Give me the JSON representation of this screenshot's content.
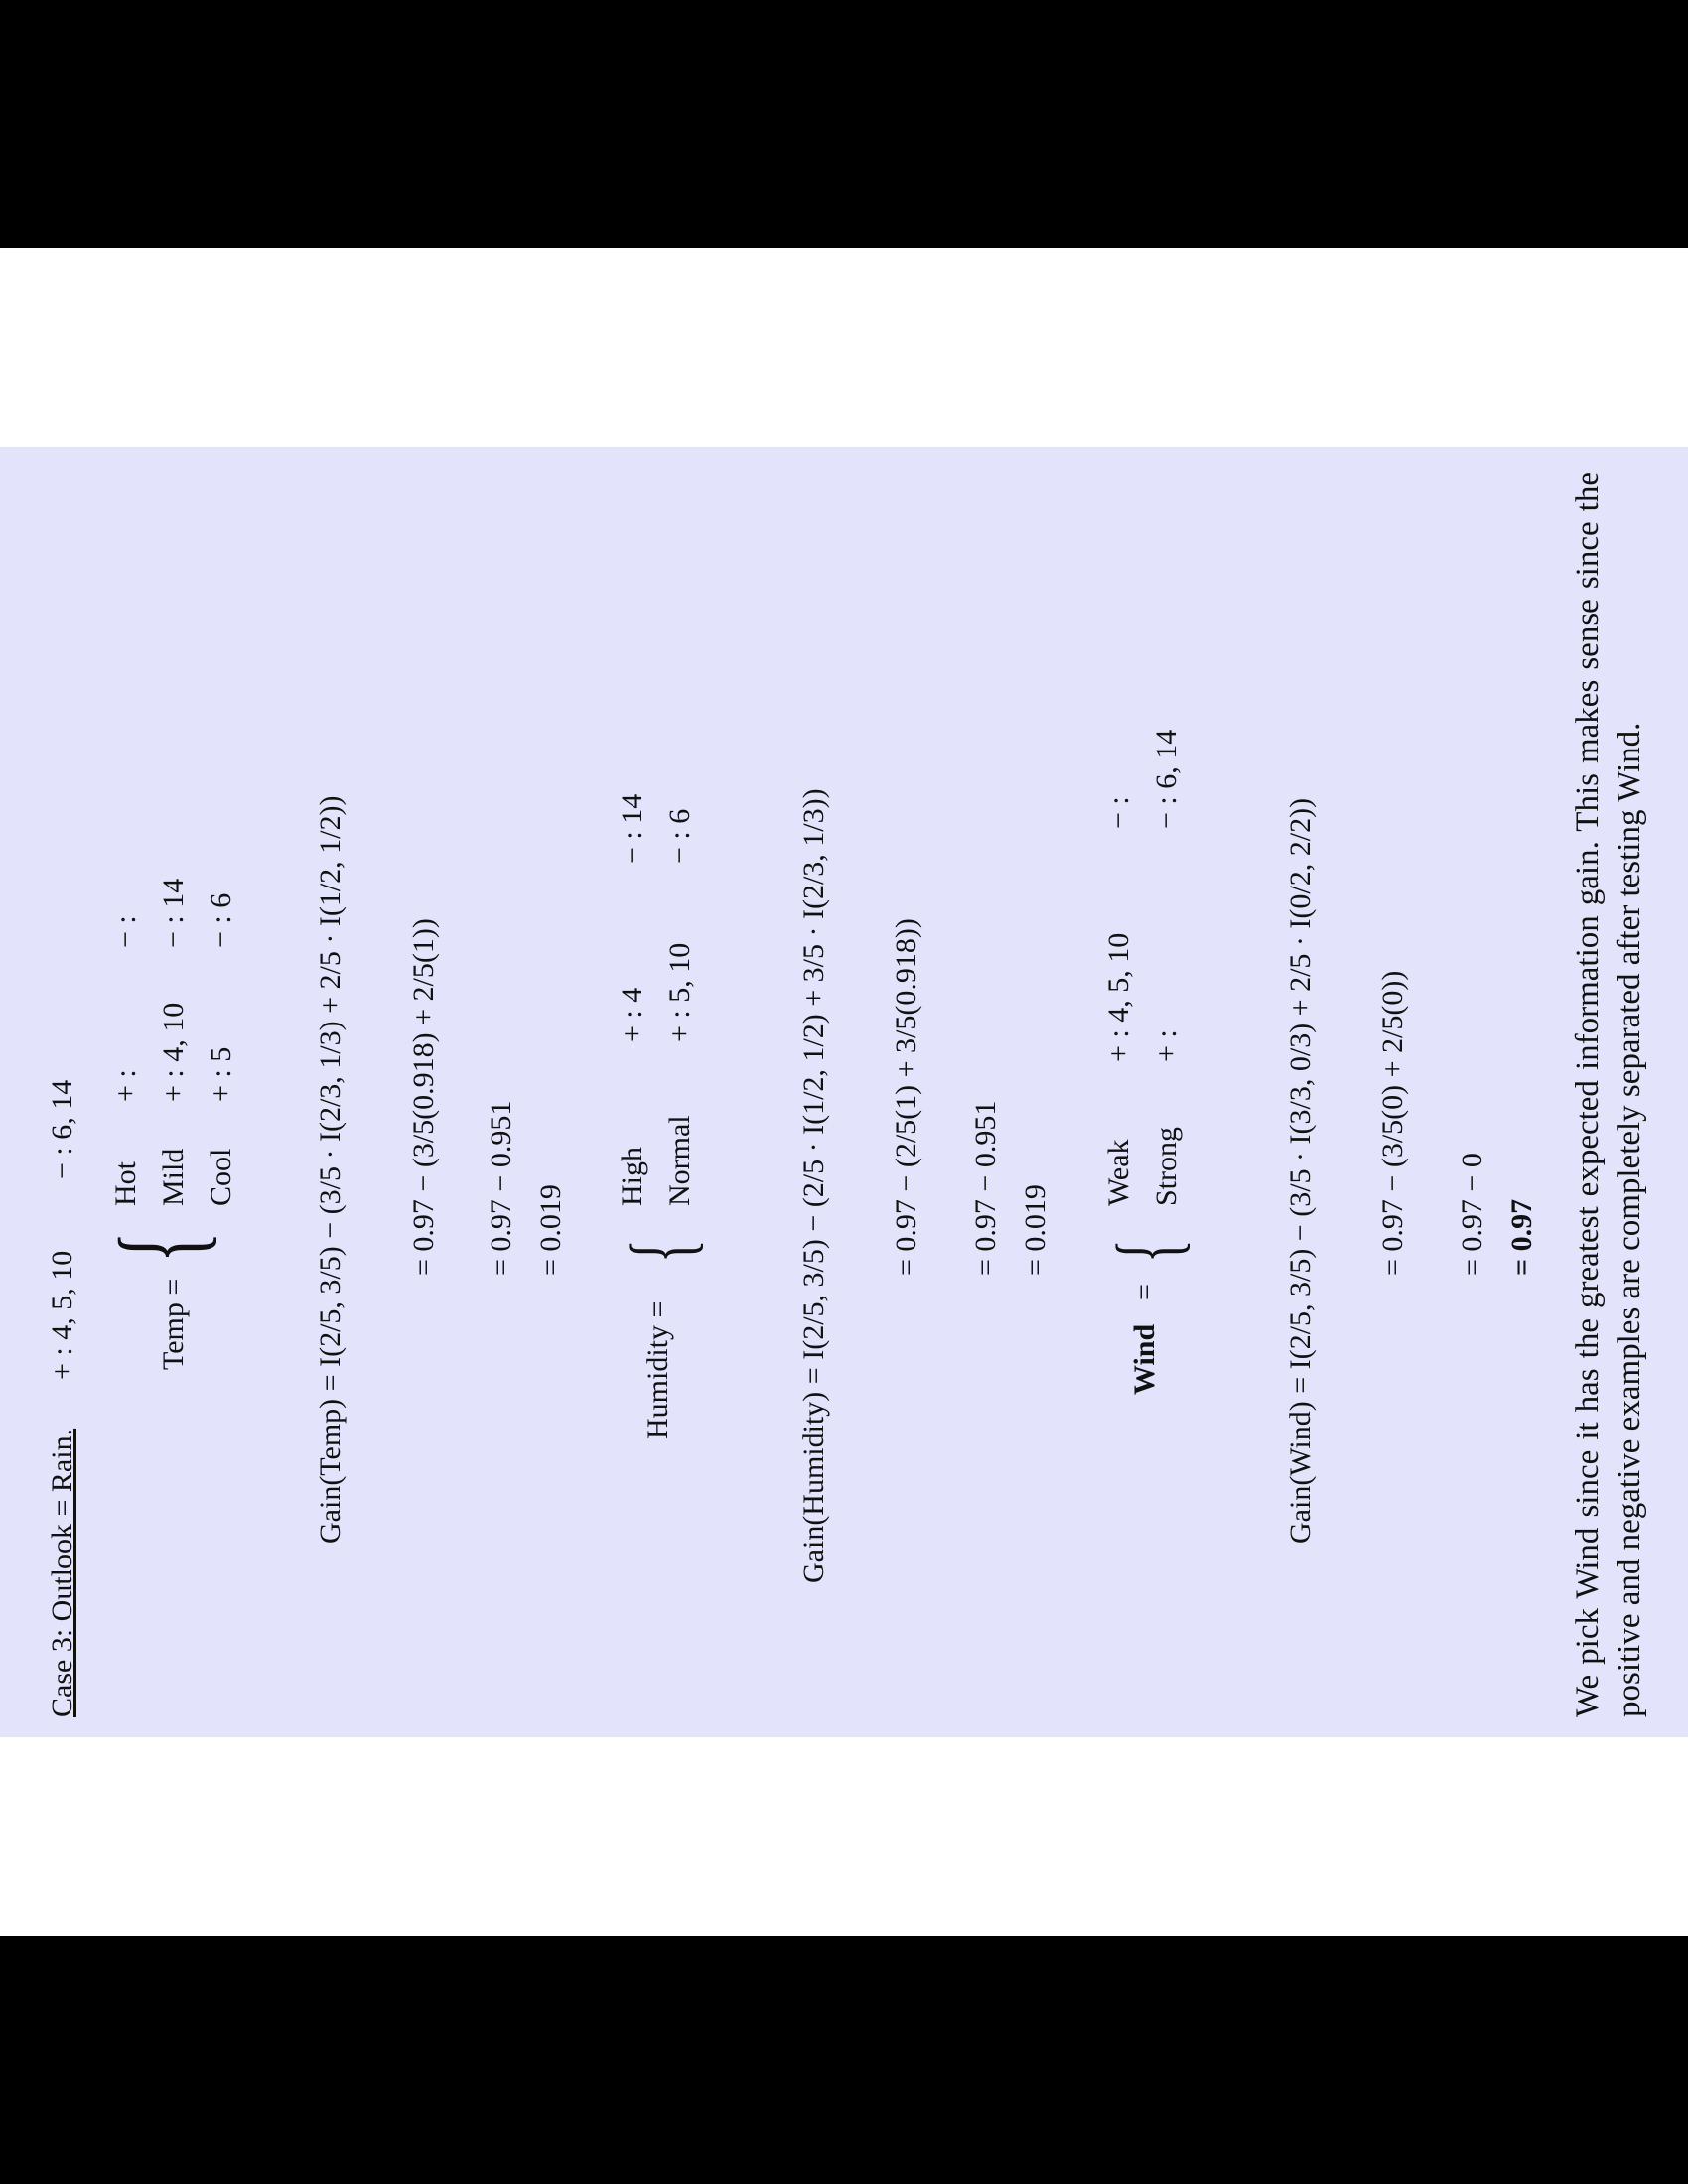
{
  "case3": {
    "heading": "Case 3: Outlook = Rain.",
    "pos": "+ : 4, 5, 10",
    "neg": "− : 6, 14"
  },
  "temp": {
    "label": "Temp =",
    "rows": [
      {
        "name": "Hot",
        "pos": "+ :",
        "neg": "− :"
      },
      {
        "name": "Mild",
        "pos": "+ : 4, 10",
        "neg": "− : 14"
      },
      {
        "name": "Cool",
        "pos": "+ : 5",
        "neg": "− : 6"
      }
    ],
    "gain_lines": [
      "Gain(Temp) = I(2/5, 3/5) − (3/5 · I(2/3, 1/3) + 2/5 · I(1/2, 1/2))",
      "= 0.97 − (3/5(0.918) + 2/5(1))",
      "= 0.97 − 0.951",
      "= 0.019"
    ]
  },
  "humidity": {
    "label": "Humidity =",
    "rows": [
      {
        "name": "High",
        "pos": "+ : 4",
        "neg": "− : 14"
      },
      {
        "name": "Normal",
        "pos": "+ : 5, 10",
        "neg": "− : 6"
      }
    ],
    "gain_lines": [
      "Gain(Humidity) = I(2/5, 3/5) − (2/5 · I(1/2, 1/2) + 3/5 · I(2/3, 1/3))",
      "= 0.97 − (2/5(1) + 3/5(0.918))",
      "= 0.97 − 0.951",
      "= 0.019"
    ]
  },
  "wind": {
    "label": "Wind",
    "eq": "=",
    "rows": [
      {
        "name": "Weak",
        "pos": "+ : 4, 5, 10",
        "neg": "− :"
      },
      {
        "name": "Strong",
        "pos": "+ :",
        "neg": "− : 6, 14"
      }
    ],
    "gain_lines": [
      "Gain(Wind) = I(2/5, 3/5) − (3/5 · I(3/3, 0/3) + 2/5 · I(0/2, 2/2))",
      "= 0.97 − (3/5(0) + 2/5(0))",
      "= 0.97 − 0",
      "= 0.97"
    ]
  },
  "conclusion": "We pick Wind since it has the greatest expected information gain. This makes sense since the positive and negative examples are completely separated after testing Wind."
}
